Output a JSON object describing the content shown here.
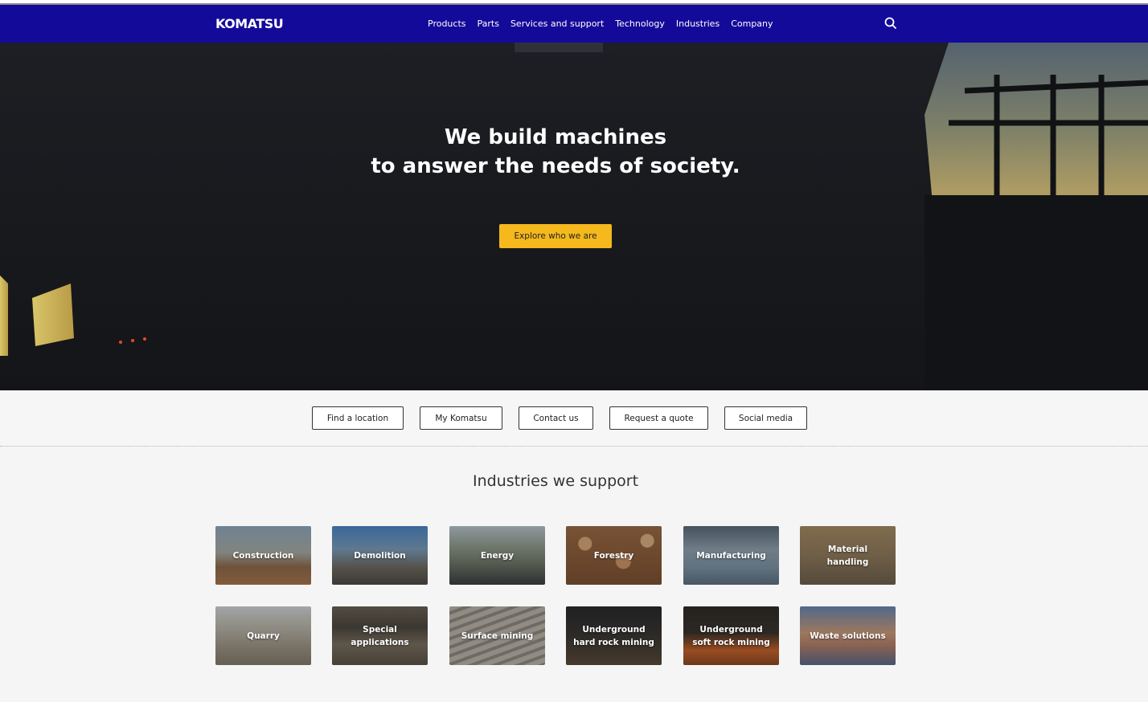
{
  "brand": {
    "logo_text": "KOMATSU",
    "primary_color": "#140a9a",
    "accent_color": "#f5b81d"
  },
  "nav": {
    "items": [
      "Products",
      "Parts",
      "Services and support",
      "Technology",
      "Industries",
      "Company"
    ],
    "search_icon": "search-icon"
  },
  "hero": {
    "title_line1": "We build machines",
    "title_line2": "to answer the needs of society.",
    "cta_label": "Explore who we are"
  },
  "quick_links": [
    "Find a location",
    "My Komatsu",
    "Contact us",
    "Request a quote",
    "Social media"
  ],
  "industries": {
    "title": "Industries we support",
    "tiles": [
      "Construction",
      "Demolition",
      "Energy",
      "Forestry",
      "Manufacturing",
      "Material\nhandling",
      "Quarry",
      "Special\napplications",
      "Surface mining",
      "Underground\nhard rock mining",
      "Underground\nsoft rock mining",
      "Waste solutions"
    ]
  }
}
